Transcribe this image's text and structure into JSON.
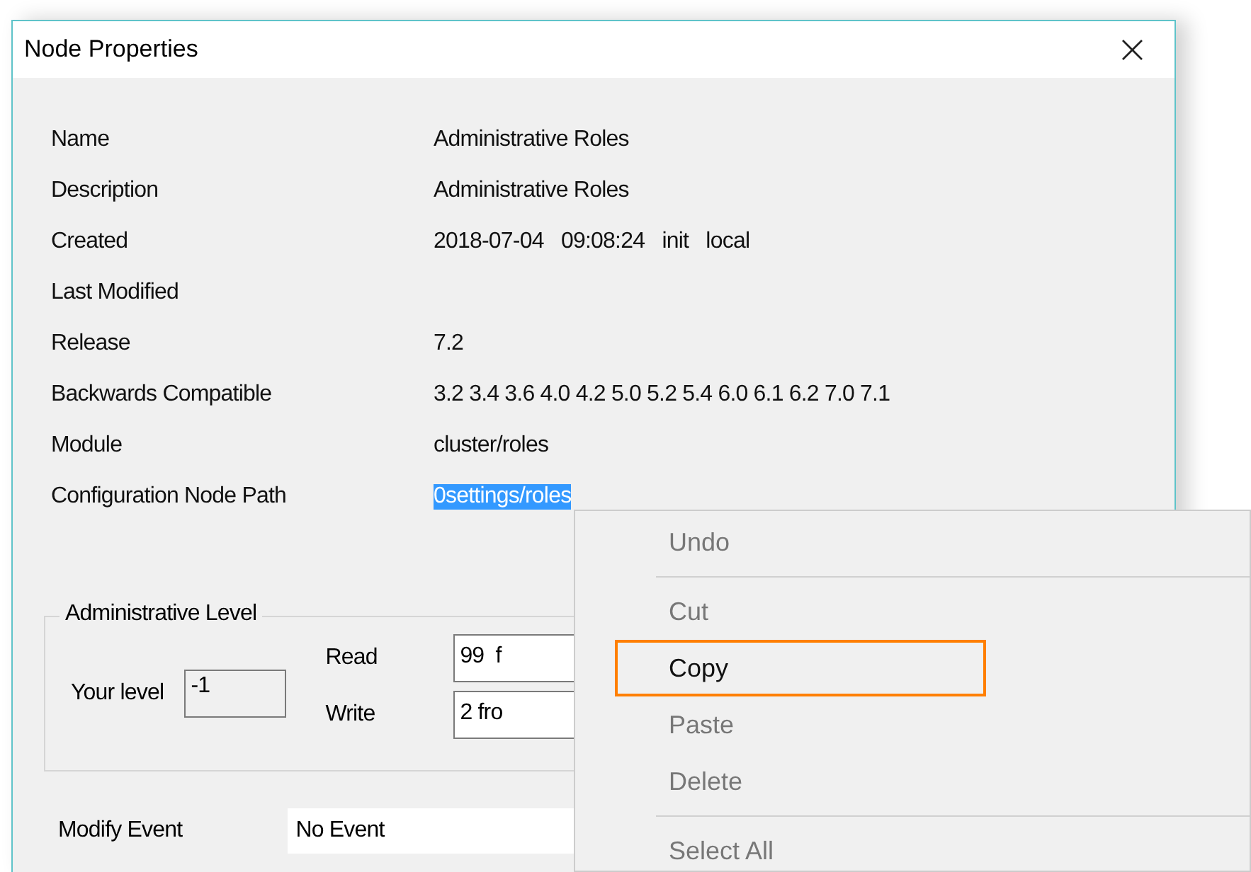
{
  "window": {
    "title": "Node Properties",
    "close": "×"
  },
  "properties": [
    {
      "label": "Name",
      "value": "Administrative Roles"
    },
    {
      "label": "Description",
      "value": "Administrative Roles"
    },
    {
      "label": "Created",
      "value": "2018-07-04   09:08:24   init   local"
    },
    {
      "label": "Last Modified"
    },
    {
      "label": "Release",
      "value": "7.2"
    },
    {
      "label": "Backwards Compatible",
      "value": "3.2 3.4 3.6 4.0 4.2 5.0 5.2 5.4 6.0 6.1 6.2 7.0 7.1"
    },
    {
      "label": "Module",
      "value": "cluster/roles"
    },
    {
      "label": "Configuration Node Path",
      "value": "0settings/roles",
      "selected": true
    }
  ],
  "admin_level": {
    "title": "Administrative Level",
    "your_level_label": "Your level",
    "your_level": "-1",
    "read_label": "Read",
    "read": "99  f",
    "write_label": "Write",
    "write": "2 fro"
  },
  "modify_event": {
    "label": "Modify Event",
    "value": "No Event"
  },
  "context_menu": [
    {
      "kind": "item",
      "label": "Undo",
      "disabled": true,
      "highlighted": false
    },
    {
      "kind": "separator"
    },
    {
      "kind": "item",
      "label": "Cut",
      "disabled": true,
      "highlighted": false
    },
    {
      "kind": "item",
      "label": "Copy",
      "disabled": false,
      "highlighted": true
    },
    {
      "kind": "item",
      "label": "Paste",
      "disabled": true,
      "highlighted": false
    },
    {
      "kind": "item",
      "label": "Delete",
      "disabled": true,
      "highlighted": false
    },
    {
      "kind": "separator"
    },
    {
      "kind": "item",
      "label": "Select All",
      "disabled": true,
      "highlighted": false
    }
  ]
}
